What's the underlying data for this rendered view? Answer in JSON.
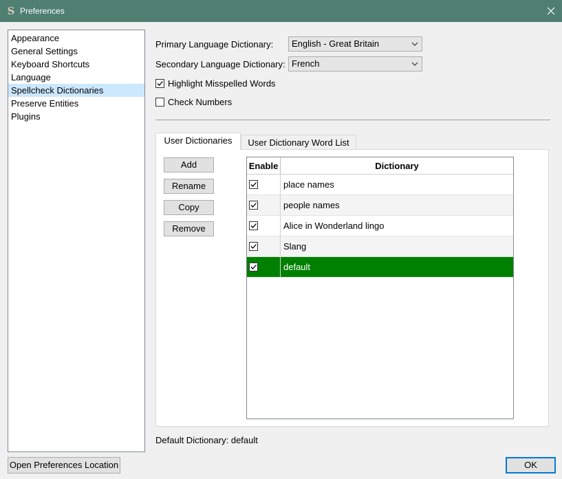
{
  "window": {
    "title": "Preferences",
    "app_icon_glyph": "S"
  },
  "sidebar": {
    "items": [
      {
        "label": "Appearance"
      },
      {
        "label": "General Settings"
      },
      {
        "label": "Keyboard Shortcuts"
      },
      {
        "label": "Language"
      },
      {
        "label": "Spellcheck Dictionaries"
      },
      {
        "label": "Preserve Entities"
      },
      {
        "label": "Plugins"
      }
    ],
    "selected_index": 4
  },
  "spellcheck": {
    "primary_label": "Primary Language Dictionary:",
    "primary_value": "English - Great Britain",
    "secondary_label": "Secondary Language Dictionary:",
    "secondary_value": "French",
    "highlight_label": "Highlight Misspelled Words",
    "highlight_checked": true,
    "check_numbers_label": "Check Numbers",
    "check_numbers_checked": false
  },
  "tabs": [
    {
      "label": "User Dictionaries"
    },
    {
      "label": "User Dictionary Word List"
    }
  ],
  "active_tab": 0,
  "buttons": {
    "add": "Add",
    "rename": "Rename",
    "copy": "Copy",
    "remove": "Remove"
  },
  "table": {
    "headers": {
      "enable": "Enable",
      "dictionary": "Dictionary"
    },
    "rows": [
      {
        "name": "place names",
        "enabled": true
      },
      {
        "name": "people names",
        "enabled": true
      },
      {
        "name": "Alice in Wonderland lingo",
        "enabled": true
      },
      {
        "name": "Slang",
        "enabled": true
      },
      {
        "name": "default",
        "enabled": true
      }
    ],
    "selected_index": 4
  },
  "default_dictionary": {
    "label": "Default Dictionary:",
    "value": "default"
  },
  "footer": {
    "open_location": "Open Preferences Location",
    "ok": "OK"
  },
  "colors": {
    "titlebar": "#4f7f71",
    "selection_green": "#008000",
    "sidebar_selected": "#cce8ff",
    "focus_blue": "#0078d7"
  },
  "icons": {
    "close": "close-icon",
    "dropdown": "chevron-down-icon",
    "checkbox": "checkmark-icon",
    "app": "app-logo-icon"
  }
}
